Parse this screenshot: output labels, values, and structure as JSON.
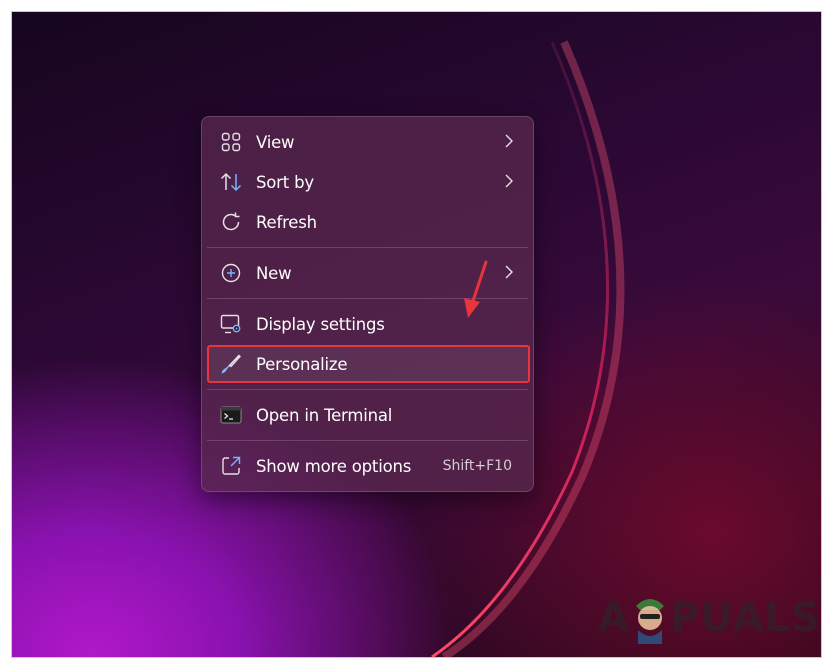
{
  "context_menu": {
    "items": [
      {
        "label": "View",
        "icon": "grid-view-icon",
        "submenu": true
      },
      {
        "label": "Sort by",
        "icon": "sort-arrows-icon",
        "submenu": true
      },
      {
        "label": "Refresh",
        "icon": "refresh-icon",
        "submenu": false
      },
      {
        "label": "New",
        "icon": "plus-circle-icon",
        "submenu": true
      },
      {
        "label": "Display settings",
        "icon": "display-settings-icon",
        "submenu": false
      },
      {
        "label": "Personalize",
        "icon": "paintbrush-icon",
        "submenu": false,
        "highlighted": true
      },
      {
        "label": "Open in Terminal",
        "icon": "terminal-icon",
        "submenu": false
      },
      {
        "label": "Show more options",
        "icon": "expand-icon",
        "submenu": false,
        "shortcut": "Shift+F10"
      }
    ]
  },
  "annotation": {
    "highlight_color": "#e8343c",
    "arrow_color": "#e8343c"
  },
  "watermark": {
    "text_left": "A",
    "text_right": "PUALS"
  }
}
